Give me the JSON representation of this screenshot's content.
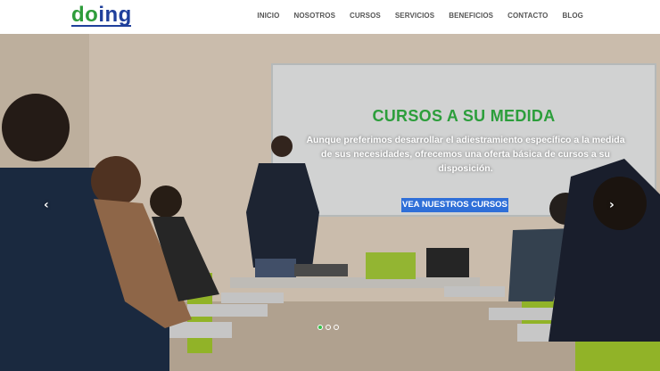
{
  "brand": {
    "logo_text_part1": "do",
    "logo_text_part2": "ing"
  },
  "nav": {
    "items": [
      {
        "label": "INICIO"
      },
      {
        "label": "NOSOTROS"
      },
      {
        "label": "CURSOS"
      },
      {
        "label": "SERVICIOS"
      },
      {
        "label": "BENEFICIOS"
      },
      {
        "label": "CONTACTO"
      },
      {
        "label": "BLOG"
      }
    ]
  },
  "hero": {
    "title": "CURSOS A SU MEDIDA",
    "text": "Aunque preferimos desarrollar el adiestramiento específico a la medida de sus necesidades, ofrecemos una oferta básica de cursos a su disposición.",
    "cta": "VEA NUESTROS CURSOS",
    "prev_icon": "chevron-left-icon",
    "next_icon": "chevron-right-icon",
    "slides_total": 3,
    "active_slide": 1
  },
  "colors": {
    "brand_green": "#2e9c3b",
    "brand_blue": "#1f3f9b",
    "cta_blue": "#2f6fd8",
    "title_green": "#2c9e3b"
  }
}
